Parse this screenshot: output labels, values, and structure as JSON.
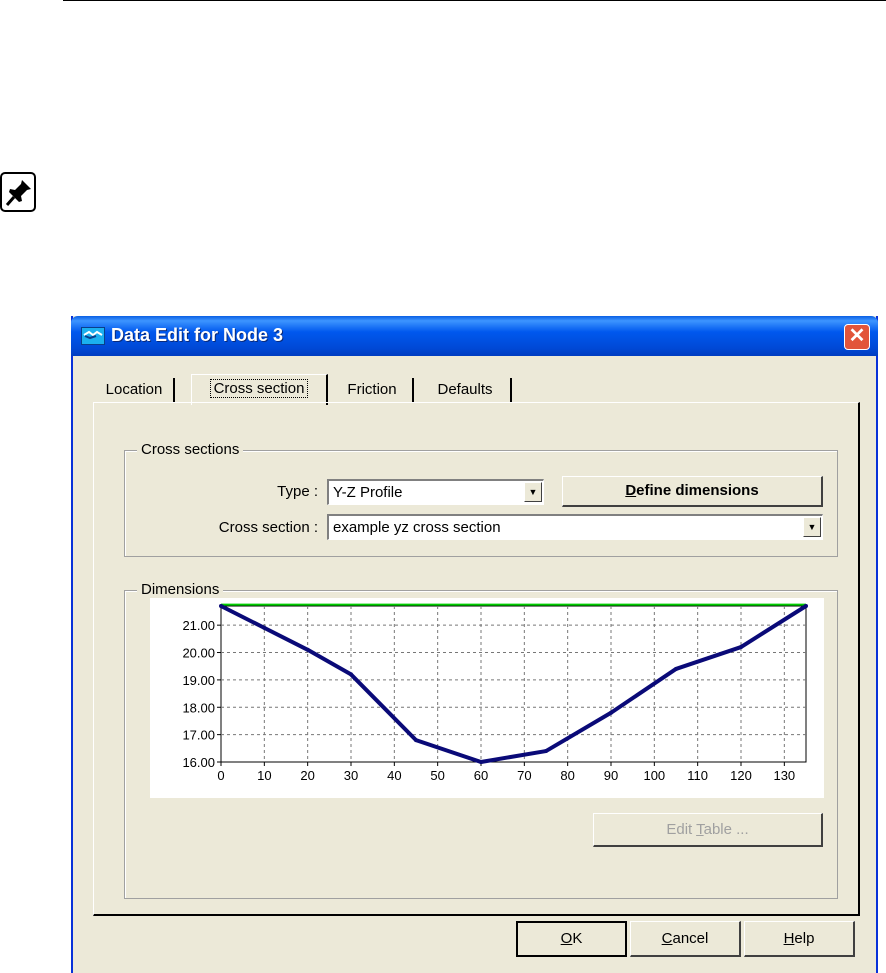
{
  "dialog": {
    "title": "Data Edit for Node 3",
    "close_glyph": "✕"
  },
  "tabs": [
    {
      "label": "Location"
    },
    {
      "label": "Cross section"
    },
    {
      "label": "Friction"
    },
    {
      "label": "Defaults"
    }
  ],
  "cross_sections": {
    "group_label": "Cross sections",
    "type_label": "Type :",
    "type_value": "Y-Z Profile",
    "define_button": {
      "prefix": "",
      "mnemonic": "D",
      "rest": "efine dimensions"
    },
    "cross_section_label": "Cross section :",
    "cross_section_value": "example yz cross section"
  },
  "dimensions": {
    "group_label": "Dimensions",
    "edit_table_button": {
      "prefix": "Edit ",
      "mnemonic": "T",
      "rest": "able ..."
    }
  },
  "buttons": {
    "ok": {
      "prefix": "",
      "mnemonic": "O",
      "rest": "K"
    },
    "cancel": {
      "prefix": "",
      "mnemonic": "C",
      "rest": "ancel"
    },
    "help": {
      "prefix": "",
      "mnemonic": "H",
      "rest": "elp"
    }
  },
  "colors": {
    "profile_line": "#0a0a78",
    "water_level_line": "#00cc00"
  },
  "chart_data": {
    "type": "line",
    "x_ticks": [
      0,
      10,
      20,
      30,
      40,
      50,
      60,
      70,
      80,
      90,
      100,
      110,
      120,
      130
    ],
    "y_ticks": [
      "16.00",
      "17.00",
      "18.00",
      "19.00",
      "20.00",
      "21.00"
    ],
    "xlim": [
      0,
      135
    ],
    "ylim": [
      16,
      21.7
    ],
    "grid": true,
    "series": [
      {
        "values_x": [
          0,
          10,
          20,
          30,
          45,
          60,
          75,
          90,
          105,
          120,
          135
        ],
        "values_y": [
          21.7,
          20.9,
          20.1,
          19.2,
          16.8,
          16.0,
          16.4,
          17.8,
          19.4,
          20.2,
          21.7
        ]
      }
    ],
    "reference_line_y": 21.75
  }
}
